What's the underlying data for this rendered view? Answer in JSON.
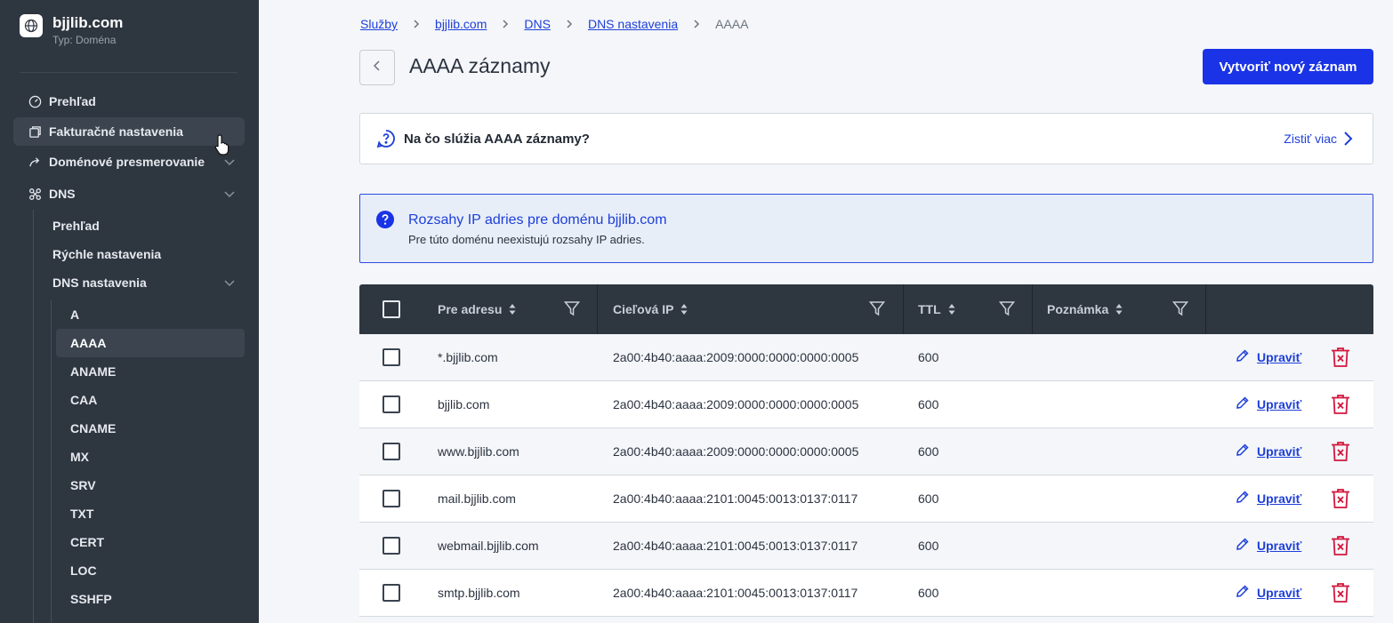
{
  "sidebar": {
    "brand_title": "bjjlib.com",
    "brand_subtitle": "Typ: Doména",
    "nav": [
      {
        "label": "Prehľad",
        "icon": "gauge-icon"
      },
      {
        "label": "Fakturačné nastavenia",
        "icon": "billing-icon"
      },
      {
        "label": "Doménové presmerovanie",
        "icon": "redirect-icon"
      },
      {
        "label": "DNS",
        "icon": "dns-icon"
      }
    ],
    "dns_sub": [
      "Prehľad",
      "Rýchle nastavenia",
      "DNS nastavenia"
    ],
    "record_types": [
      "A",
      "AAAA",
      "ANAME",
      "CAA",
      "CNAME",
      "MX",
      "SRV",
      "TXT",
      "CERT",
      "LOC",
      "SSHFP"
    ],
    "active_record_type": "AAAA"
  },
  "breadcrumb": [
    "Služby",
    "bjjlib.com",
    "DNS",
    "DNS nastavenia",
    "AAAA"
  ],
  "page_title": "AAAA záznamy",
  "create_button": "Vytvoriť nový záznam",
  "faq": {
    "title": "Na čo slúžia AAAA záznamy?",
    "link": "Zistiť viac"
  },
  "info": {
    "title": "Rozsahy IP adries pre doménu bjjlib.com",
    "text": "Pre túto doménu neexistujú rozsahy IP adries."
  },
  "table": {
    "columns": [
      "Pre adresu",
      "Cieľová IP",
      "TTL",
      "Poznámka"
    ],
    "edit_label": "Upraviť",
    "rows": [
      {
        "host": "*.bjjlib.com",
        "ip": "2a00:4b40:aaaa:2009:0000:0000:0000:0005",
        "ttl": "600",
        "note": ""
      },
      {
        "host": "bjjlib.com",
        "ip": "2a00:4b40:aaaa:2009:0000:0000:0000:0005",
        "ttl": "600",
        "note": ""
      },
      {
        "host": "www.bjjlib.com",
        "ip": "2a00:4b40:aaaa:2009:0000:0000:0000:0005",
        "ttl": "600",
        "note": ""
      },
      {
        "host": "mail.bjjlib.com",
        "ip": "2a00:4b40:aaaa:2101:0045:0013:0137:0117",
        "ttl": "600",
        "note": ""
      },
      {
        "host": "webmail.bjjlib.com",
        "ip": "2a00:4b40:aaaa:2101:0045:0013:0137:0117",
        "ttl": "600",
        "note": ""
      },
      {
        "host": "smtp.bjjlib.com",
        "ip": "2a00:4b40:aaaa:2101:0045:0013:0137:0117",
        "ttl": "600",
        "note": ""
      }
    ]
  },
  "colors": {
    "accent": "#1a33e6",
    "sidebar": "#2e3640",
    "delete": "#d2163c"
  }
}
